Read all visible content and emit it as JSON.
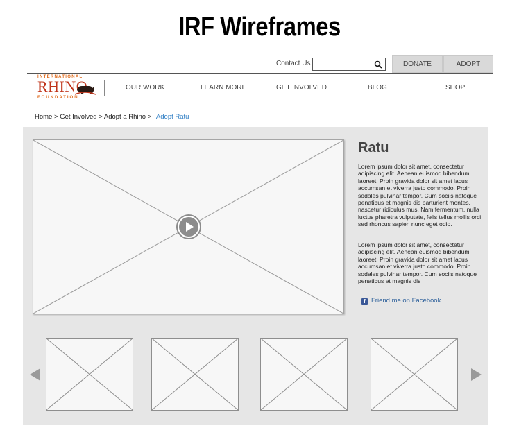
{
  "page": {
    "title": "IRF Wireframes"
  },
  "utility": {
    "contact_label": "Contact Us",
    "search_value": "",
    "donate_label": "DONATE",
    "adopt_label": "ADOPT"
  },
  "logo": {
    "top_text": "INTERNATIONAL",
    "main_text": "RHINO",
    "bottom_text": "FOUNDATION"
  },
  "nav": {
    "items": [
      {
        "label": "OUR WORK"
      },
      {
        "label": "LEARN MORE"
      },
      {
        "label": "GET INVOLVED"
      },
      {
        "label": "BLOG"
      },
      {
        "label": "SHOP"
      }
    ]
  },
  "breadcrumb": {
    "items": [
      "Home",
      "Get Involved",
      "Adopt a Rhino"
    ],
    "separator": ">",
    "current": "Adopt Ratu"
  },
  "content": {
    "name": "Ratu",
    "paragraph_1": "Lorem ipsum dolor sit amet, consectetur adipiscing elit. Aenean euismod bibendum laoreet. Proin gravida dolor sit amet lacus accumsan et viverra justo commodo. Proin sodales pulvinar tempor. Cum sociis natoque penatibus et magnis dis parturient montes, nascetur ridiculus mus. Nam fermentum, nulla luctus pharetra vulputate, felis tellus mollis orci, sed rhoncus sapien nunc eget odio.",
    "paragraph_2": "Lorem ipsum dolor sit amet, consectetur adipiscing elit. Aenean euismod bibendum laoreet. Proin gravida dolor sit amet lacus accumsan et viverra justo commodo. Proin sodales pulvinar tempor. Cum sociis natoque penatibus et magnis dis",
    "facebook_label": "Friend me on Facebook",
    "facebook_icon": "facebook-icon",
    "video_icon": "play-icon"
  },
  "carousel": {
    "thumbnail_count": 4,
    "prev_icon": "arrow-left-icon",
    "next_icon": "arrow-right-icon"
  },
  "colors": {
    "panel": "#e6e6e6",
    "button": "#d9d9d9",
    "link": "#2f7ec4",
    "facebook": "#3b5998",
    "logo_red": "#c0341a",
    "logo_orange": "#e06a1a"
  }
}
